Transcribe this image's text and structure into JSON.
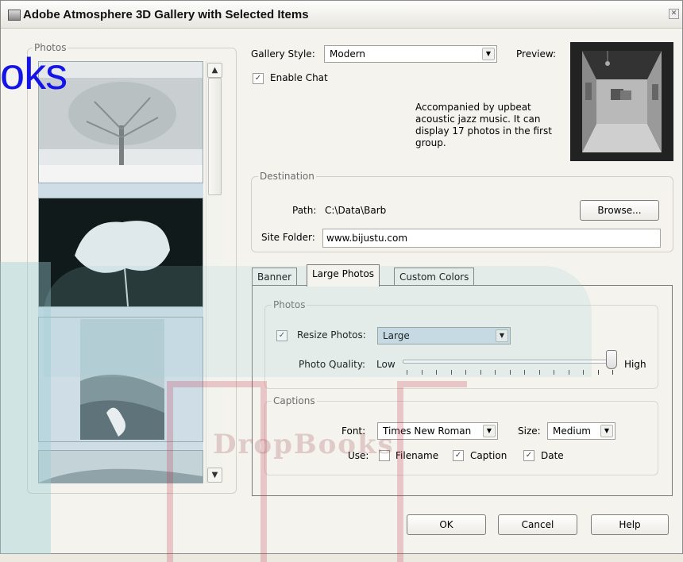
{
  "window": {
    "title": "Adobe Atmosphere 3D Gallery with Selected Items"
  },
  "photos": {
    "legend": "Photos",
    "items": [
      {
        "name": "Snowy tree"
      },
      {
        "name": "White poppy"
      },
      {
        "name": "Desert dunes with figure"
      },
      {
        "name": "Dunes"
      }
    ]
  },
  "gallery": {
    "style_label": "Gallery Style:",
    "style_value": "Modern",
    "preview_label": "Preview:",
    "enable_chat_label": "Enable Chat",
    "enable_chat_checked": true,
    "description": "Accompanied by upbeat acoustic jazz music. It can display 17 photos in the first group."
  },
  "destination": {
    "legend": "Destination",
    "path_label": "Path:",
    "path_value": "C:\\Data\\Barb",
    "browse_label": "Browse...",
    "site_folder_label": "Site Folder:",
    "site_folder_value": "www.bijustu.com"
  },
  "tabs": [
    {
      "label": "Banner",
      "active": false
    },
    {
      "label": "Large Photos",
      "active": true
    },
    {
      "label": "Custom Colors",
      "active": false
    }
  ],
  "large_photos": {
    "photos_legend": "Photos",
    "resize_label": "Resize Photos:",
    "resize_checked": true,
    "resize_value": "Large",
    "quality_label": "Photo Quality:",
    "quality_low": "Low",
    "quality_high": "High",
    "quality_level": 1.0,
    "captions_legend": "Captions",
    "font_label": "Font:",
    "font_value": "Times New Roman",
    "size_label": "Size:",
    "size_value": "Medium",
    "use_label": "Use:",
    "use_options": [
      {
        "label": "Filename",
        "checked": false
      },
      {
        "label": "Caption",
        "checked": true
      },
      {
        "label": "Date",
        "checked": true
      }
    ]
  },
  "buttons": {
    "ok": "OK",
    "cancel": "Cancel",
    "help": "Help"
  },
  "watermark": {
    "text": "oks",
    "brand": "DropBooks"
  }
}
